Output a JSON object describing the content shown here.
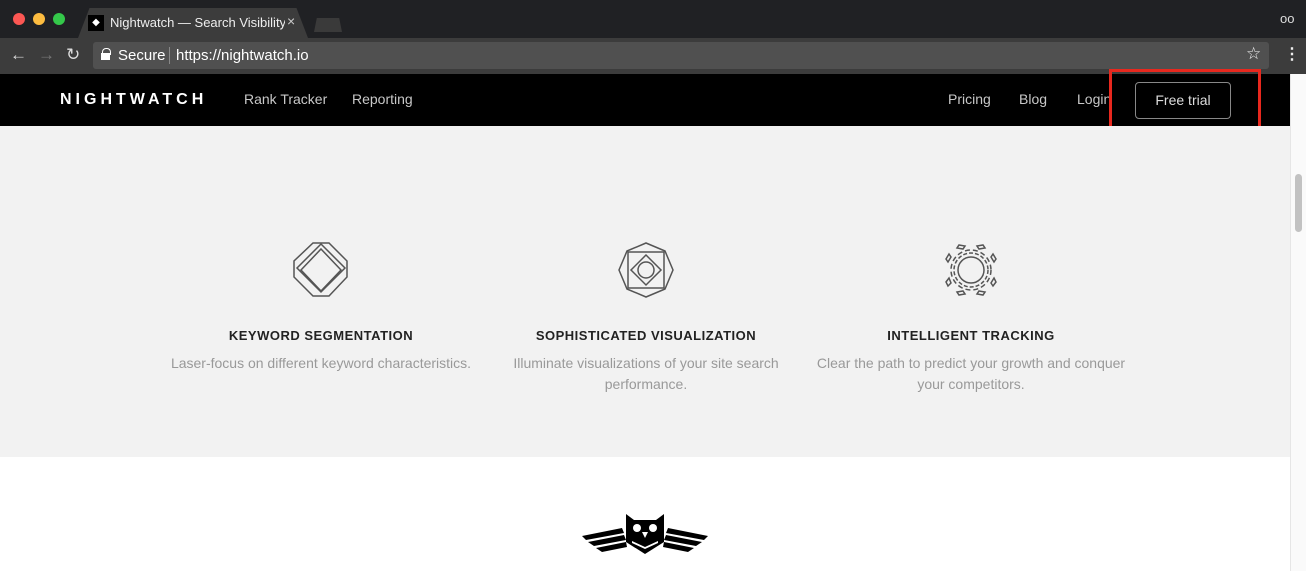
{
  "browser": {
    "tab_title": "Nightwatch — Search Visibility",
    "tab_close": "×",
    "security_label": "Secure",
    "url": "https://nightwatch.io",
    "icons": {
      "back": "←",
      "forward": "→",
      "reload": "↻",
      "star": "☆",
      "menu": "⋮",
      "incognito": "oo"
    }
  },
  "site_nav": {
    "logo": "NIGHTWATCH",
    "left_links": [
      "Rank Tracker",
      "Reporting"
    ],
    "right_links": [
      "Pricing",
      "Blog",
      "Login"
    ],
    "cta": "Free trial"
  },
  "features": [
    {
      "icon": "diamond-icon",
      "title": "KEYWORD SEGMENTATION",
      "desc": "Laser-focus on different keyword characteristics."
    },
    {
      "icon": "octagon-square-icon",
      "title": "SOPHISTICATED VISUALIZATION",
      "desc": "Illuminate visualizations of your site search performance."
    },
    {
      "icon": "circle-ring-icon",
      "title": "INTELLIGENT TRACKING",
      "desc": "Clear the path to predict your growth and conquer your competitors."
    }
  ],
  "annotation": {
    "highlight_color": "#e8281e"
  }
}
